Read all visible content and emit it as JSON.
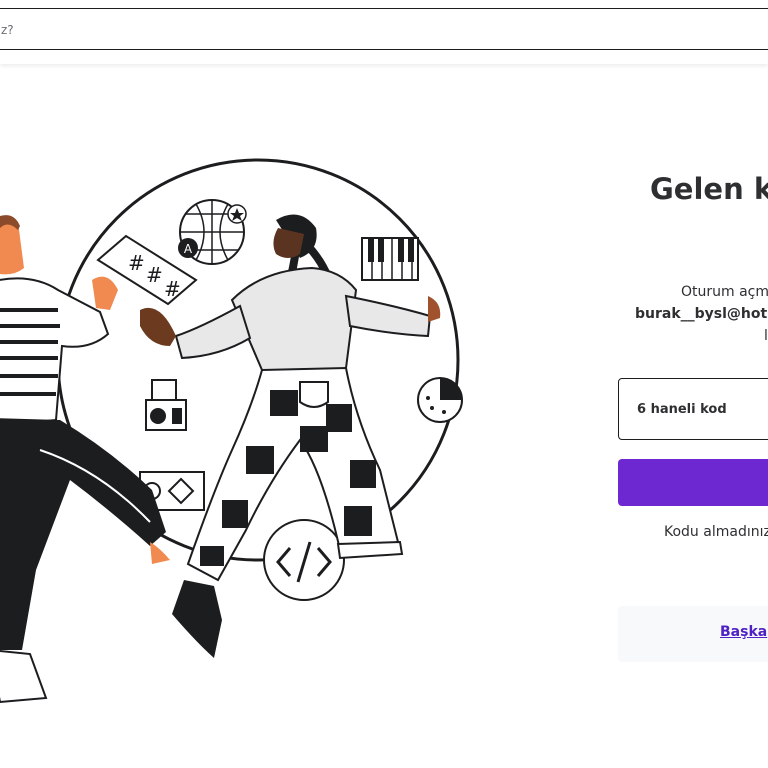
{
  "search": {
    "text": "z?"
  },
  "login": {
    "title": "Gelen ku",
    "info_line1": "Oturum açm",
    "info_email": "burak__bysl@hotr",
    "info_line3": "l",
    "code_placeholder": "6 haneli kod",
    "resend_text": "Kodu almadınız",
    "other_link": "Başka"
  },
  "colors": {
    "accent": "#6d28d2",
    "link": "#5022c3"
  }
}
